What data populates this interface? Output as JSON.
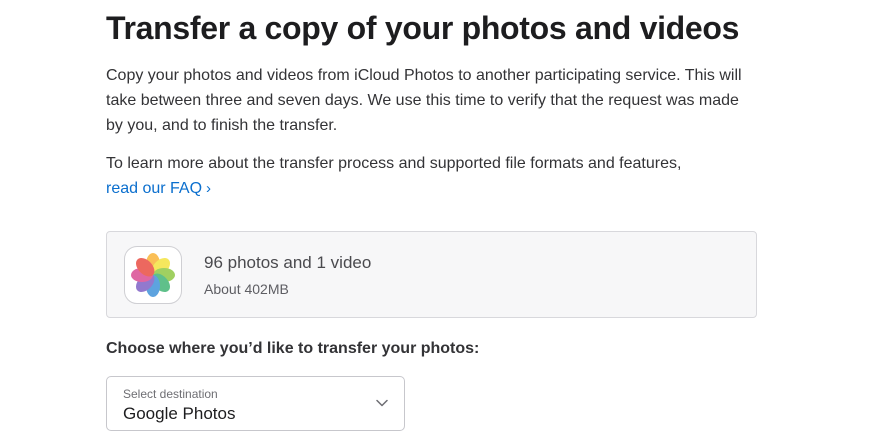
{
  "header": {
    "title": "Transfer a copy of your photos and videos"
  },
  "intro": {
    "paragraph1": "Copy your photos and videos from iCloud Photos to another participating service. This will take between three and seven days. We use this time to verify that the request was made by you, and to finish the transfer.",
    "paragraph2_prefix": "To learn more about the transfer process and supported file formats and features,",
    "faq_link": "read our FAQ",
    "faq_chevron": "›",
    "link_color": "#0b6fce"
  },
  "library": {
    "icon": "photos-app-icon",
    "count_label": "96 photos and 1 video",
    "size_label": "About 402MB"
  },
  "destination": {
    "prompt": "Choose where you’d like to transfer your photos:",
    "select_label": "Select destination",
    "selected_value": "Google Photos",
    "icon": "chevron-down-icon"
  }
}
